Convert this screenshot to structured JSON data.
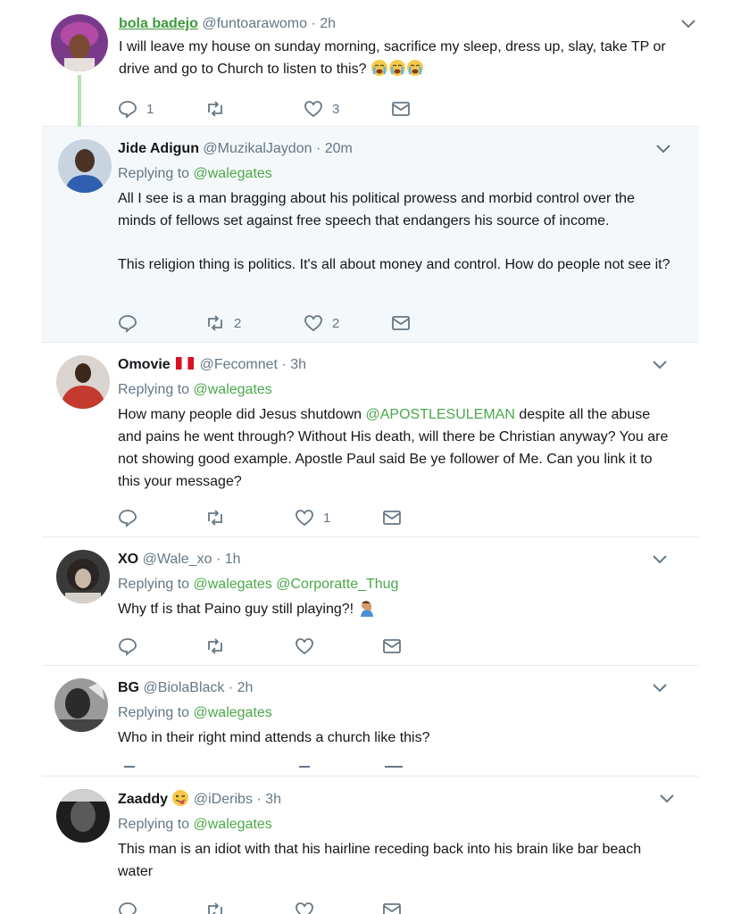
{
  "tweets": [
    {
      "name": "bola badejo",
      "handle": "@funtoarawomo",
      "time": "· 2h",
      "reply_label": "",
      "reply_mentions": [],
      "body": [
        "I will leave my house on sunday morning, sacrifice my sleep, dress up, slay, take TP or drive and go to Church to listen to this?"
      ],
      "emoji_tail": "crying-face-emoji ×3",
      "counts": {
        "reply": "1",
        "retweet": "",
        "like": "3"
      }
    },
    {
      "name": "Jide Adigun",
      "handle": "@MuzikalJaydon",
      "time": "· 20m",
      "reply_label": "Replying to",
      "reply_mentions": [
        "@walegates"
      ],
      "body": [
        "All I see is a man bragging about his political prowess and morbid control over the minds of fellows set against free speech that endangers his source of income.",
        "This religion thing is politics. It's all about money and control. How do people not see it?"
      ],
      "counts": {
        "reply": "",
        "retweet": "2",
        "like": "2"
      }
    },
    {
      "name": "Omovie",
      "handle": "@Fecomnet",
      "time": "· 3h",
      "reply_label": "Replying to",
      "reply_mentions": [
        "@walegates"
      ],
      "body_pre": "How many people did Jesus shutdown ",
      "body_mention": "@APOSTLESULEMAN",
      "body_post": " despite all the abuse and pains he went through? Without His death, will there be Christian anyway? You are not showing good example.  Apostle Paul said Be ye follower of Me. Can you link it to this your message?",
      "counts": {
        "reply": "",
        "retweet": "",
        "like": "1"
      }
    },
    {
      "name": "XO",
      "handle": "@Wale_xo",
      "time": "· 1h",
      "reply_label": "Replying to",
      "reply_mentions": [
        "@walegates",
        "@Corporatte_Thug"
      ],
      "body": [
        "Why tf is that Paino guy still playing?!"
      ],
      "counts": {
        "reply": "",
        "retweet": "",
        "like": ""
      }
    },
    {
      "name": "BG",
      "handle": "@BiolaBlack",
      "time": "· 2h",
      "reply_label": "Replying to",
      "reply_mentions": [
        "@walegates"
      ],
      "body": [
        "Who in their right mind attends a church like this?"
      ],
      "counts": {
        "reply": "",
        "retweet": "",
        "like": ""
      }
    },
    {
      "name": "Zaaddy",
      "handle": "@iDeribs",
      "time": "· 3h",
      "reply_label": "Replying to",
      "reply_mentions": [
        "@walegates"
      ],
      "body": [
        "This man is an idiot with that his hairline receding back into his brain like bar beach water"
      ],
      "counts": {
        "reply": "",
        "retweet": "",
        "like": ""
      }
    }
  ],
  "colors": {
    "accent_green": "#4aa84a",
    "muted": "#657786",
    "border": "#e6ecf0"
  }
}
